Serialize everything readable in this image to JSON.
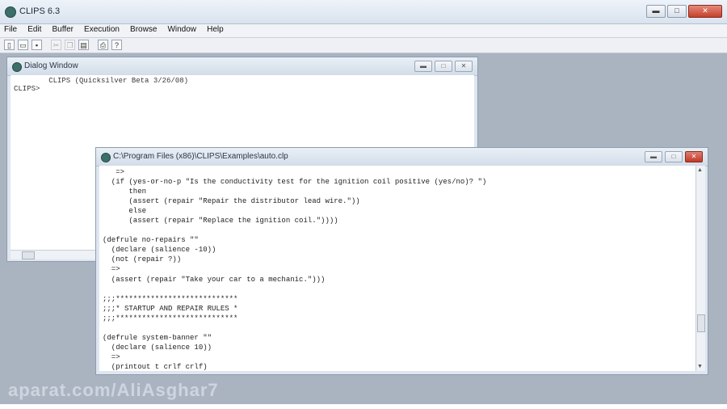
{
  "app": {
    "title": "CLIPS 6.3"
  },
  "window_controls": {
    "minimize": "▬",
    "maximize": "□",
    "close": "✕"
  },
  "menu": [
    "File",
    "Edit",
    "Buffer",
    "Execution",
    "Browse",
    "Window",
    "Help"
  ],
  "toolbar": [
    {
      "icon": "new-file-icon",
      "glyph": "▯",
      "enabled": true
    },
    {
      "icon": "open-folder-icon",
      "glyph": "▭",
      "enabled": true
    },
    {
      "icon": "save-icon",
      "glyph": "▪",
      "enabled": true
    },
    {
      "icon": "cut-icon",
      "glyph": "✂",
      "enabled": false
    },
    {
      "icon": "copy-icon",
      "glyph": "❐",
      "enabled": false
    },
    {
      "icon": "paste-icon",
      "glyph": "▤",
      "enabled": true
    },
    {
      "icon": "print-icon",
      "glyph": "⎙",
      "enabled": true
    },
    {
      "icon": "help-icon",
      "glyph": "?",
      "enabled": true
    }
  ],
  "dialog": {
    "title": "Dialog Window",
    "content": "        CLIPS (Quicksilver Beta 3/26/08)\nCLIPS>"
  },
  "editor": {
    "title": "C:\\Program Files (x86)\\CLIPS\\Examples\\auto.clp",
    "content": "   =>\n  (if (yes-or-no-p \"Is the conductivity test for the ignition coil positive (yes/no)? \")\n      then\n      (assert (repair \"Repair the distributor lead wire.\"))\n      else\n      (assert (repair \"Replace the ignition coil.\"))))\n\n(defrule no-repairs \"\"\n  (declare (salience -10))\n  (not (repair ?))\n  =>\n  (assert (repair \"Take your car to a mechanic.\")))\n\n;;;****************************\n;;;* STARTUP AND REPAIR RULES *\n;;;****************************\n\n(defrule system-banner \"\"\n  (declare (salience 10))\n  =>\n  (printout t crlf crlf)"
  },
  "watermark": "aparat.com/AliAsghar7"
}
